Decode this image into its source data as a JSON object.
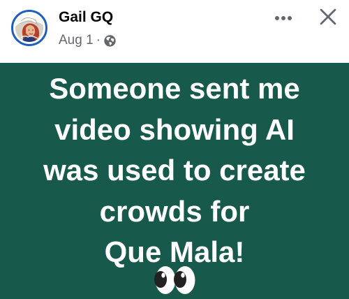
{
  "post": {
    "author": "Gail GQ",
    "date": "Aug 1",
    "separator": "·",
    "privacy_icon": "globe-icon",
    "actions": {
      "more_icon": "more-icon",
      "close_icon": "close-icon"
    },
    "background_color": "#17594a",
    "text_lines": [
      "Someone sent me",
      "video showing AI",
      "was used to create",
      "crowds for",
      "Que Mala!"
    ],
    "emoji": "eyes-emoji"
  }
}
